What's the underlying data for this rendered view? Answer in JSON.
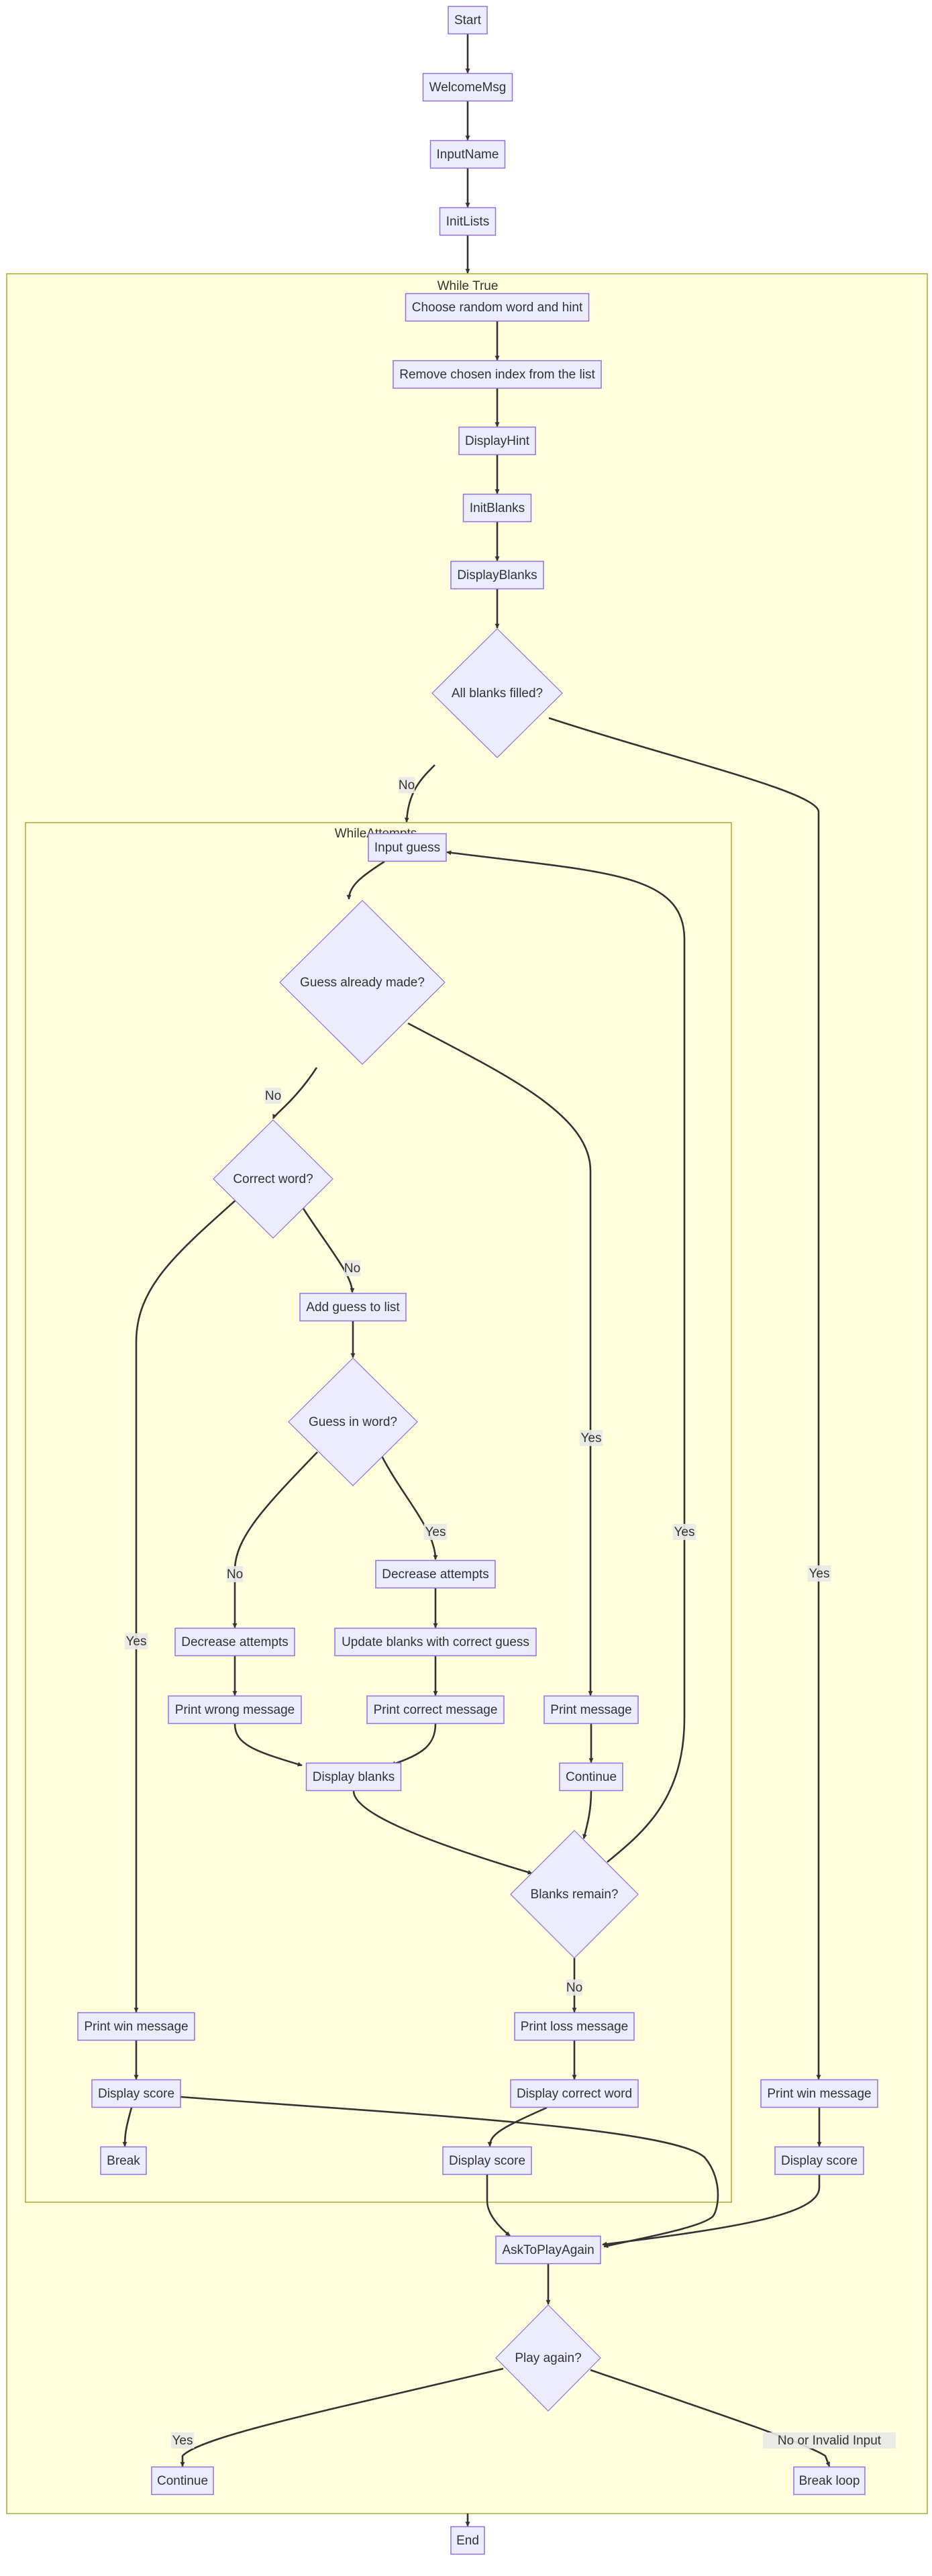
{
  "diagram": {
    "type": "flowchart",
    "colors": {
      "node_fill": "#ececff",
      "node_stroke": "#9370db",
      "cluster_fill": "#ffffde",
      "cluster_stroke": "#aaaa33",
      "edge": "#333333",
      "text": "#333333",
      "edge_label_bg": "#e8e8e8"
    },
    "clusters": [
      {
        "id": "while_true",
        "title": "While True"
      },
      {
        "id": "while_attempts",
        "title": "WhileAttempts"
      }
    ],
    "nodes": [
      {
        "id": "start",
        "label": "Start",
        "shape": "rect"
      },
      {
        "id": "welcome",
        "label": "WelcomeMsg",
        "shape": "rect"
      },
      {
        "id": "input_name",
        "label": "InputName",
        "shape": "rect"
      },
      {
        "id": "init_lists",
        "label": "InitLists",
        "shape": "rect"
      },
      {
        "id": "choose_word",
        "label": "Choose random word and hint",
        "shape": "rect"
      },
      {
        "id": "remove_index",
        "label": "Remove chosen index from the list",
        "shape": "rect"
      },
      {
        "id": "display_hint",
        "label": "DisplayHint",
        "shape": "rect"
      },
      {
        "id": "init_blanks",
        "label": "InitBlanks",
        "shape": "rect"
      },
      {
        "id": "display_blanks_top",
        "label": "DisplayBlanks",
        "shape": "rect"
      },
      {
        "id": "all_blanks_filled",
        "label": "All blanks filled?",
        "shape": "diamond"
      },
      {
        "id": "input_guess",
        "label": "Input guess",
        "shape": "rect"
      },
      {
        "id": "guess_made",
        "label": "Guess already made?",
        "shape": "diamond"
      },
      {
        "id": "correct_word",
        "label": "Correct word?",
        "shape": "diamond"
      },
      {
        "id": "add_guess",
        "label": "Add guess to list",
        "shape": "rect"
      },
      {
        "id": "guess_in_word",
        "label": "Guess in word?",
        "shape": "diamond"
      },
      {
        "id": "decrease_yes",
        "label": "Decrease attempts",
        "shape": "rect"
      },
      {
        "id": "decrease_no",
        "label": "Decrease attempts",
        "shape": "rect"
      },
      {
        "id": "update_blanks",
        "label": "Update blanks with correct guess",
        "shape": "rect"
      },
      {
        "id": "print_wrong",
        "label": "Print wrong message",
        "shape": "rect"
      },
      {
        "id": "print_correct",
        "label": "Print correct message",
        "shape": "rect"
      },
      {
        "id": "print_message",
        "label": "Print message",
        "shape": "rect"
      },
      {
        "id": "display_blanks",
        "label": "Display blanks",
        "shape": "rect"
      },
      {
        "id": "continue_inner",
        "label": "Continue",
        "shape": "rect"
      },
      {
        "id": "blanks_remain",
        "label": "Blanks remain?",
        "shape": "diamond"
      },
      {
        "id": "print_win_inner",
        "label": "Print win message",
        "shape": "rect"
      },
      {
        "id": "print_loss",
        "label": "Print loss message",
        "shape": "rect"
      },
      {
        "id": "display_score_win",
        "label": "Display score",
        "shape": "rect"
      },
      {
        "id": "display_correct_word",
        "label": "Display correct word",
        "shape": "rect"
      },
      {
        "id": "print_win_outer",
        "label": "Print win message",
        "shape": "rect"
      },
      {
        "id": "break_inner",
        "label": "Break",
        "shape": "rect"
      },
      {
        "id": "display_score_loss",
        "label": "Display score",
        "shape": "rect"
      },
      {
        "id": "display_score_outer",
        "label": "Display score",
        "shape": "rect"
      },
      {
        "id": "ask_play_again",
        "label": "AskToPlayAgain",
        "shape": "rect"
      },
      {
        "id": "play_again",
        "label": "Play again?",
        "shape": "diamond"
      },
      {
        "id": "continue_outer",
        "label": "Continue",
        "shape": "rect"
      },
      {
        "id": "break_loop",
        "label": "Break loop",
        "shape": "rect"
      },
      {
        "id": "end",
        "label": "End",
        "shape": "rect"
      }
    ],
    "edges": [
      {
        "from": "start",
        "to": "welcome",
        "label": ""
      },
      {
        "from": "welcome",
        "to": "input_name",
        "label": ""
      },
      {
        "from": "input_name",
        "to": "init_lists",
        "label": ""
      },
      {
        "from": "init_lists",
        "to": "while_true",
        "label": ""
      },
      {
        "from": "choose_word",
        "to": "remove_index",
        "label": ""
      },
      {
        "from": "remove_index",
        "to": "display_hint",
        "label": ""
      },
      {
        "from": "display_hint",
        "to": "init_blanks",
        "label": ""
      },
      {
        "from": "init_blanks",
        "to": "display_blanks_top",
        "label": ""
      },
      {
        "from": "display_blanks_top",
        "to": "all_blanks_filled",
        "label": ""
      },
      {
        "from": "all_blanks_filled",
        "to": "while_attempts",
        "label": "No"
      },
      {
        "from": "all_blanks_filled",
        "to": "print_win_outer",
        "label": "Yes"
      },
      {
        "from": "input_guess",
        "to": "guess_made",
        "label": ""
      },
      {
        "from": "guess_made",
        "to": "correct_word",
        "label": "No"
      },
      {
        "from": "guess_made",
        "to": "print_message",
        "label": "Yes"
      },
      {
        "from": "correct_word",
        "to": "add_guess",
        "label": "No"
      },
      {
        "from": "correct_word",
        "to": "print_win_inner",
        "label": "Yes"
      },
      {
        "from": "add_guess",
        "to": "guess_in_word",
        "label": ""
      },
      {
        "from": "guess_in_word",
        "to": "decrease_yes",
        "label": "Yes"
      },
      {
        "from": "guess_in_word",
        "to": "decrease_no",
        "label": "No"
      },
      {
        "from": "decrease_yes",
        "to": "update_blanks",
        "label": ""
      },
      {
        "from": "update_blanks",
        "to": "print_correct",
        "label": ""
      },
      {
        "from": "decrease_no",
        "to": "print_wrong",
        "label": ""
      },
      {
        "from": "print_wrong",
        "to": "display_blanks",
        "label": ""
      },
      {
        "from": "print_correct",
        "to": "display_blanks",
        "label": ""
      },
      {
        "from": "print_message",
        "to": "continue_inner",
        "label": ""
      },
      {
        "from": "continue_inner",
        "to": "blanks_remain",
        "label": ""
      },
      {
        "from": "display_blanks",
        "to": "blanks_remain",
        "label": ""
      },
      {
        "from": "blanks_remain",
        "to": "input_guess",
        "label": "Yes"
      },
      {
        "from": "blanks_remain",
        "to": "print_loss",
        "label": "No"
      },
      {
        "from": "print_win_inner",
        "to": "display_score_win",
        "label": ""
      },
      {
        "from": "display_score_win",
        "to": "break_inner",
        "label": ""
      },
      {
        "from": "display_score_win",
        "to": "ask_play_again",
        "label": ""
      },
      {
        "from": "print_loss",
        "to": "display_correct_word",
        "label": ""
      },
      {
        "from": "display_correct_word",
        "to": "display_score_loss",
        "label": ""
      },
      {
        "from": "display_score_loss",
        "to": "ask_play_again",
        "label": ""
      },
      {
        "from": "print_win_outer",
        "to": "display_score_outer",
        "label": ""
      },
      {
        "from": "display_score_outer",
        "to": "ask_play_again",
        "label": ""
      },
      {
        "from": "ask_play_again",
        "to": "play_again",
        "label": ""
      },
      {
        "from": "play_again",
        "to": "continue_outer",
        "label": "Yes"
      },
      {
        "from": "play_again",
        "to": "break_loop",
        "label": "No or Invalid Input"
      },
      {
        "from": "while_true",
        "to": "end",
        "label": ""
      }
    ]
  }
}
